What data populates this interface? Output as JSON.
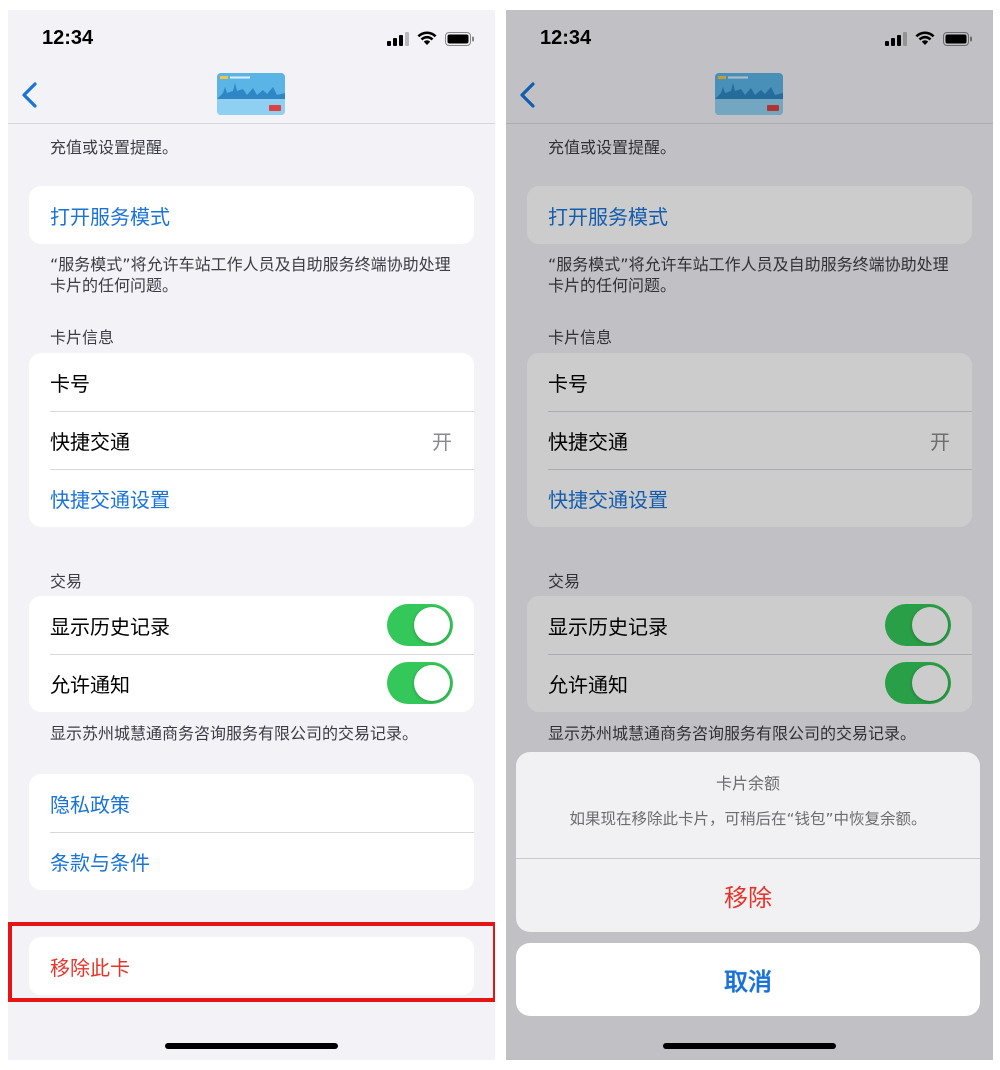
{
  "status_bar": {
    "time": "12:34"
  },
  "screen": {
    "top_text": "充值或设置提醒。",
    "service_mode": {
      "button_label": "打开服务模式",
      "footnote": "“服务模式”将允许车站工作人员及自助服务终端协助处理卡片的任何问题。"
    },
    "card_info": {
      "header": "卡片信息",
      "card_number_label": "卡号",
      "express_transit_label": "快捷交通",
      "express_transit_value": "开",
      "express_transit_settings": "快捷交通设置"
    },
    "transactions": {
      "header": "交易",
      "show_history_label": "显示历史记录",
      "show_history_on": true,
      "allow_notifications_label": "允许通知",
      "allow_notifications_on": true,
      "footnote": "显示苏州城慧通商务咨询服务有限公司的交易记录。"
    },
    "legal": {
      "privacy_policy": "隐私政策",
      "terms": "条款与条件"
    },
    "remove_card": "移除此卡"
  },
  "action_sheet": {
    "title": "卡片余额",
    "message": "如果现在移除此卡片，可稍后在“钱包”中恢复余额。",
    "remove_label": "移除",
    "cancel_label": "取消"
  },
  "colors": {
    "accent_blue": "#1a73d9",
    "destructive_red": "#e5352a",
    "toggle_green": "#34c759",
    "highlight_red": "#e51515"
  }
}
